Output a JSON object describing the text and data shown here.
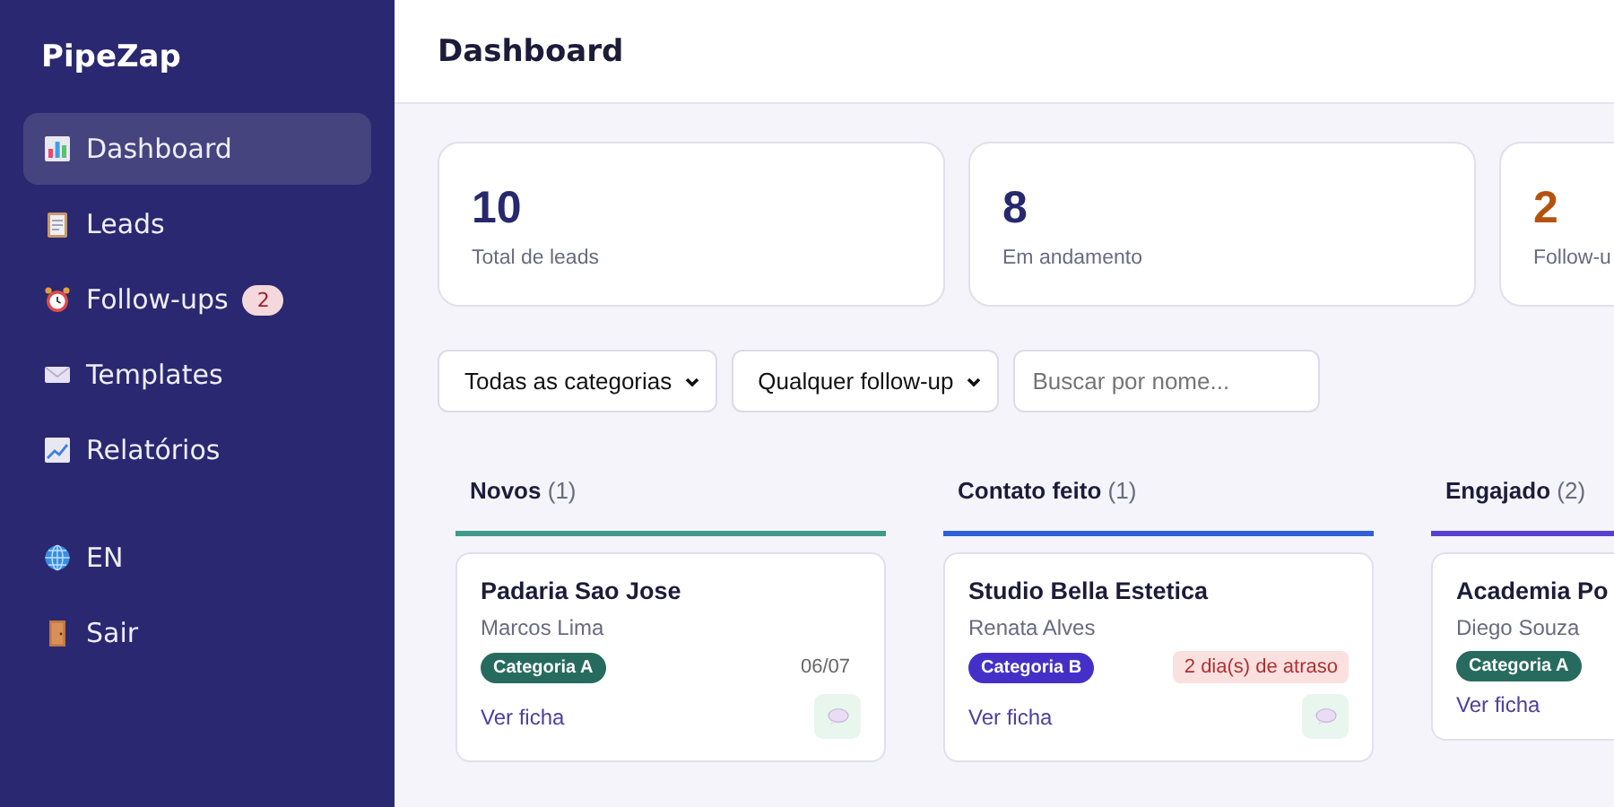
{
  "brand": "PipeZap",
  "nav": [
    {
      "label": "Dashboard",
      "selected": true
    },
    {
      "label": "Leads",
      "selected": false
    },
    {
      "label": "Follow-ups",
      "selected": false,
      "badge": "2"
    },
    {
      "label": "Templates",
      "selected": false
    },
    {
      "label": "Relatórios",
      "selected": false
    }
  ],
  "nav_bottom": [
    {
      "label": "EN"
    },
    {
      "label": "Sair"
    }
  ],
  "header": {
    "title": "Dashboard"
  },
  "stats": [
    {
      "value": "10",
      "label": "Total de leads",
      "color": "#27286e"
    },
    {
      "value": "8",
      "label": "Em andamento",
      "color": "#27286e"
    },
    {
      "value": "2",
      "label": "Follow-u",
      "color": "#b4530f"
    }
  ],
  "filters": {
    "category": "Todas as categorias",
    "followup": "Qualquer follow-up",
    "search": {
      "placeholder": "Buscar por nome..."
    }
  },
  "columns": [
    {
      "title": "Novos",
      "count": "(1)",
      "color": "#3f9a8a",
      "leads": [
        {
          "name": "Padaria Sao Jose",
          "contact": "Marcos Lima",
          "category": {
            "label": "Categoria A",
            "color": "#276b5f"
          },
          "due": "06/07",
          "overdue": false,
          "link": "Ver ficha",
          "chat": true
        }
      ]
    },
    {
      "title": "Contato feito",
      "count": "(1)",
      "color": "#2f5fd6",
      "leads": [
        {
          "name": "Studio Bella Estetica",
          "contact": "Renata Alves",
          "category": {
            "label": "Categoria B",
            "color": "#4430c9"
          },
          "due": "2 dia(s) de atraso",
          "overdue": true,
          "link": "Ver ficha",
          "chat": true
        }
      ]
    },
    {
      "title": "Engajado",
      "count": "(2)",
      "color": "#5a3fcf",
      "leads": [
        {
          "name": "Academia Po",
          "contact": "Diego Souza",
          "category": {
            "label": "Categoria A",
            "color": "#276b5f"
          },
          "link": "Ver ficha"
        }
      ]
    }
  ]
}
